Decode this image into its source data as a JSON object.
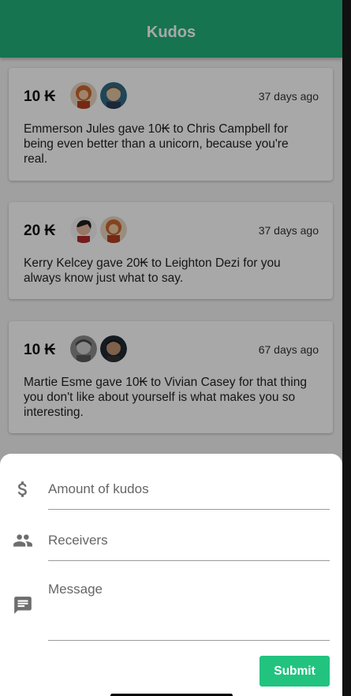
{
  "app": {
    "title": "Kudos"
  },
  "kudos": [
    {
      "amount": "10 ₭",
      "time": "37 days ago",
      "message": "Emmerson Jules gave 10₭ to Chris Campbell for being even better than a unicorn, because you're real."
    },
    {
      "amount": "20 ₭",
      "time": "37 days ago",
      "message": "Kerry Kelcey gave 20₭ to Leighton Dezi for you always know just what to say."
    },
    {
      "amount": "10 ₭",
      "time": "67 days ago",
      "message": "Martie Esme gave 10₭ to Vivian Casey for that thing you don't like about yourself is what makes you so interesting."
    }
  ],
  "form": {
    "amount_placeholder": "Amount of kudos",
    "receivers_placeholder": "Receivers",
    "message_placeholder": "Message",
    "submit_label": "Submit",
    "icons": {
      "amount": "dollar-icon",
      "receivers": "people-icon",
      "message": "message-icon"
    }
  },
  "colors": {
    "primary": "#22b07a",
    "submit": "#22c37f"
  }
}
